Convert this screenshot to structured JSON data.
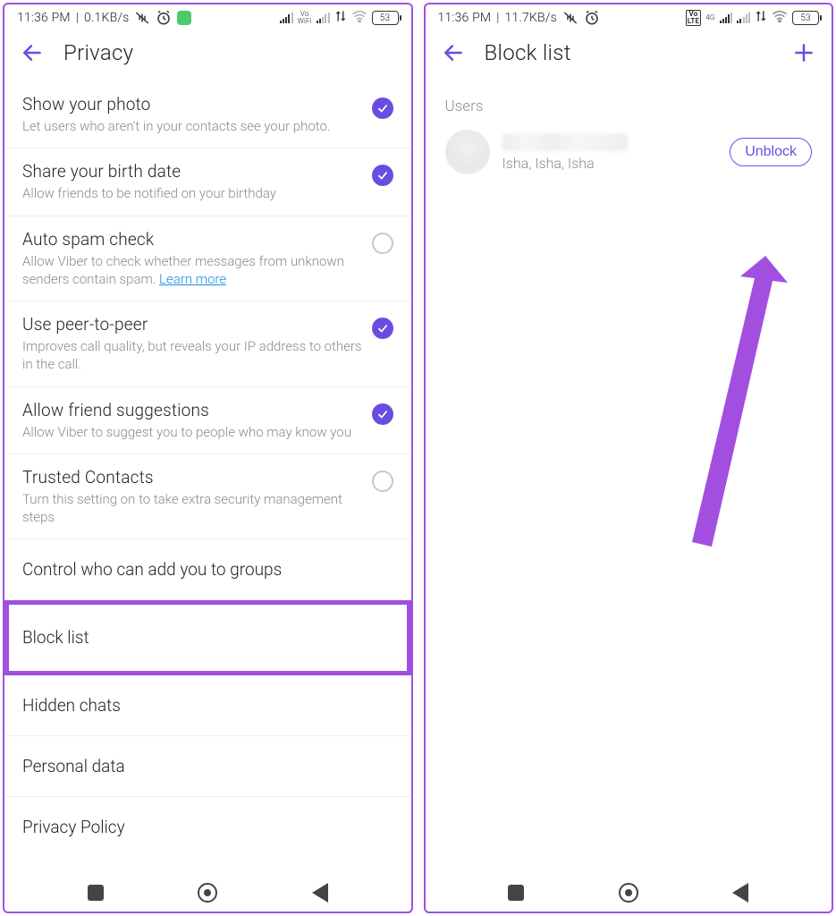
{
  "left": {
    "status": {
      "time": "11:36 PM",
      "speed": "0.1KB/s",
      "battery": "53",
      "net_label": "Vo\nWiFi"
    },
    "header": {
      "title": "Privacy"
    },
    "settings": {
      "show_photo": {
        "title": "Show your photo",
        "desc": "Let users who aren't in your contacts see your photo."
      },
      "share_bday": {
        "title": "Share your birth date",
        "desc": "Allow friends to be notified on your birthday"
      },
      "auto_spam": {
        "title": "Auto spam check",
        "desc_a": "Allow Viber to check whether messages from unknown senders contain spam. ",
        "learn_more": "Learn more"
      },
      "p2p": {
        "title": "Use peer-to-peer",
        "desc": "Improves call quality, but reveals your IP address to others in the call."
      },
      "friend_sug": {
        "title": "Allow friend suggestions",
        "desc": "Allow Viber to suggest you to people who may know you"
      },
      "trusted": {
        "title": "Trusted Contacts",
        "desc": "Turn this setting on to take extra security management steps"
      }
    },
    "links": {
      "groups": "Control who can add you to groups",
      "block_list": "Block list",
      "hidden_chats": "Hidden chats",
      "personal_data": "Personal data",
      "privacy_policy": "Privacy Policy"
    }
  },
  "right": {
    "status": {
      "time": "11:36 PM",
      "speed": "11.7KB/s",
      "battery": "53",
      "net_label": "4G",
      "lte": "Vo\nLTE"
    },
    "header": {
      "title": "Block list"
    },
    "section_label": "Users",
    "user": {
      "subtitle": "Isha, Isha, Isha",
      "unblock": "Unblock"
    }
  }
}
